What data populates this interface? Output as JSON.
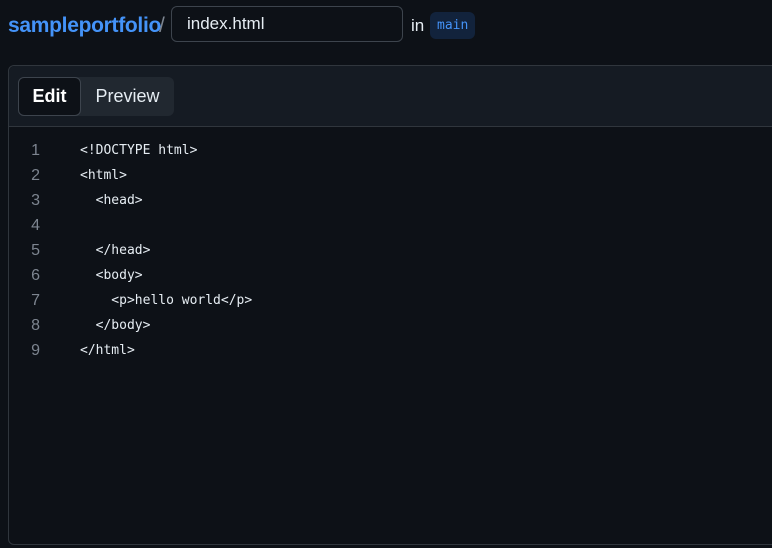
{
  "header": {
    "repo_name": "sampleportfolio",
    "separator": "/",
    "filename_value": "index.html",
    "in_label": "in",
    "branch": "main"
  },
  "editor": {
    "tabs": [
      {
        "label": "Edit",
        "active": true
      },
      {
        "label": "Preview",
        "active": false
      }
    ],
    "lines": [
      {
        "num": "1",
        "text": "<!DOCTYPE html>"
      },
      {
        "num": "2",
        "text": "<html>"
      },
      {
        "num": "3",
        "text": "  <head>"
      },
      {
        "num": "4",
        "text": ""
      },
      {
        "num": "5",
        "text": "  </head>"
      },
      {
        "num": "6",
        "text": "  <body>"
      },
      {
        "num": "7",
        "text": "    <p>hello world</p>"
      },
      {
        "num": "8",
        "text": "  </body>"
      },
      {
        "num": "9",
        "text": "</html>"
      }
    ]
  },
  "colors": {
    "background": "#0d1117",
    "link": "#4493f8",
    "border": "#30363d"
  }
}
